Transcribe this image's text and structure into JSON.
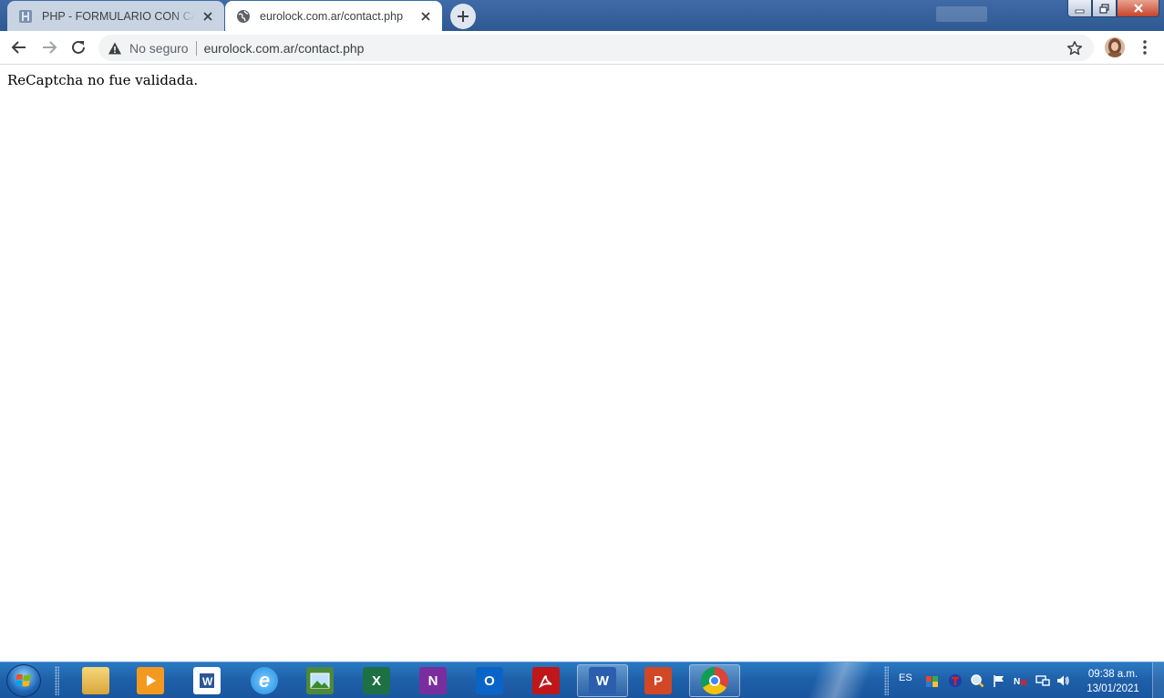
{
  "browser": {
    "tabs": [
      {
        "title": "PHP - FORMULARIO CON CAPTCHA",
        "favicon": "php-doc-icon",
        "active": false
      },
      {
        "title": "eurolock.com.ar/contact.php",
        "favicon": "globe-icon",
        "active": true
      }
    ],
    "omnibox": {
      "security_label": "No seguro",
      "url": "eurolock.com.ar/contact.php"
    }
  },
  "page": {
    "message": "ReCaptcha no fue validada."
  },
  "taskbar": {
    "apps": [
      {
        "name": "explorer",
        "icon": "folder-icon",
        "letter": "",
        "color": "#e8b84a"
      },
      {
        "name": "media-player",
        "icon": "media-player-icon",
        "letter": "",
        "color": "#f39a1e"
      },
      {
        "name": "wordpad",
        "icon": "wordpad-icon",
        "letter": "",
        "color": "#2b5797"
      },
      {
        "name": "internet-explorer",
        "icon": "internet-explorer-icon",
        "letter": "e",
        "color": "#1e8fe0"
      },
      {
        "name": "photo-viewer",
        "icon": "photo-viewer-icon",
        "letter": "",
        "color": "#4a8a3a"
      },
      {
        "name": "excel",
        "icon": "excel-icon",
        "letter": "X",
        "color": "#1d7044"
      },
      {
        "name": "onenote",
        "icon": "onenote-icon",
        "letter": "N",
        "color": "#7a2e9e"
      },
      {
        "name": "outlook",
        "icon": "outlook-icon",
        "letter": "O",
        "color": "#0a64c8"
      },
      {
        "name": "acrobat",
        "icon": "acrobat-icon",
        "letter": "",
        "color": "#c0171b"
      },
      {
        "name": "word",
        "icon": "word-icon",
        "letter": "W",
        "color": "#2b5fae"
      },
      {
        "name": "powerpoint",
        "icon": "powerpoint-icon",
        "letter": "P",
        "color": "#d24726"
      },
      {
        "name": "chrome",
        "icon": "chrome-icon",
        "letter": "",
        "color": "#ffffff"
      }
    ],
    "tray": {
      "language": "ES",
      "time": "09:38 a.m.",
      "date": "13/01/2021"
    }
  },
  "colors": {
    "titlebar": "#2e5992",
    "taskbar": "#1e5fa8",
    "omnibox_bg": "#f1f3f4"
  }
}
